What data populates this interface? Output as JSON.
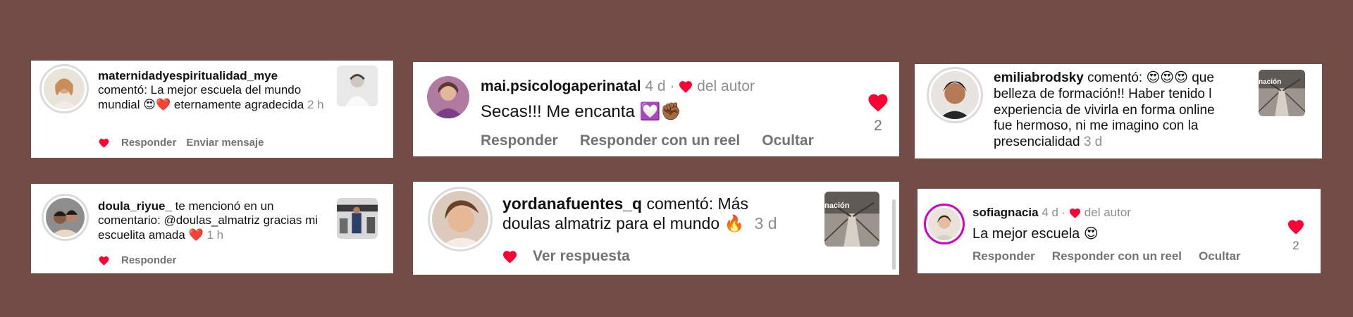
{
  "colors": {
    "background": "#734b47",
    "heart": "#ff0033",
    "muted": "#737373",
    "time": "#8e8e8e"
  },
  "cards": {
    "c1": {
      "username": "maternidadyespiritualidad_mye",
      "text": "comentó: La mejor escuela del mundo mundial",
      "emojis": "😍❤️",
      "text2": "eternamente agradecida",
      "time": "2 h",
      "actions": [
        "Responder",
        "Enviar mensaje"
      ],
      "avatar_icon": "profile-photo",
      "thumb_icon": "post-thumbnail"
    },
    "c2": {
      "username": "mai.psicologaperinatal",
      "time": "4 d",
      "separator": "·",
      "author_like": "del autor",
      "text": "Secas!!! Me encanta",
      "emojis": "💟✊🏾",
      "actions": [
        "Responder",
        "Responder con un reel",
        "Ocultar"
      ],
      "like_count": "2"
    },
    "c3": {
      "username": "emiliabrodsky",
      "verb": "comentó:",
      "emojis": "😍😍😍",
      "text": "que belleza de formación!! Haber tenido l experiencia de vivirla en forma online fue hermoso, ni me imagino con la presencialidad",
      "time": "3 d",
      "thumb_caption": "nación"
    },
    "c4": {
      "username": "doula_riyue_",
      "text": "te mencionó en un comentario: @doulas_almatriz gracias mi escuelita amada",
      "emojis": "❤️",
      "time": "1 h",
      "actions": [
        "Responder"
      ]
    },
    "c5": {
      "username": "yordanafuentes_q",
      "text": "comentó: Más doulas almatriz para el mundo",
      "emojis": "🔥",
      "time": "3 d",
      "actions": [
        "Ver respuesta"
      ],
      "thumb_caption": "nación"
    },
    "c6": {
      "username": "sofiagnacia",
      "time": "4 d",
      "separator": "·",
      "author_like": "del autor",
      "text": "La mejor escuela",
      "emojis": "😍",
      "actions": [
        "Responder",
        "Responder con un reel",
        "Ocultar"
      ],
      "like_count": "2"
    }
  }
}
